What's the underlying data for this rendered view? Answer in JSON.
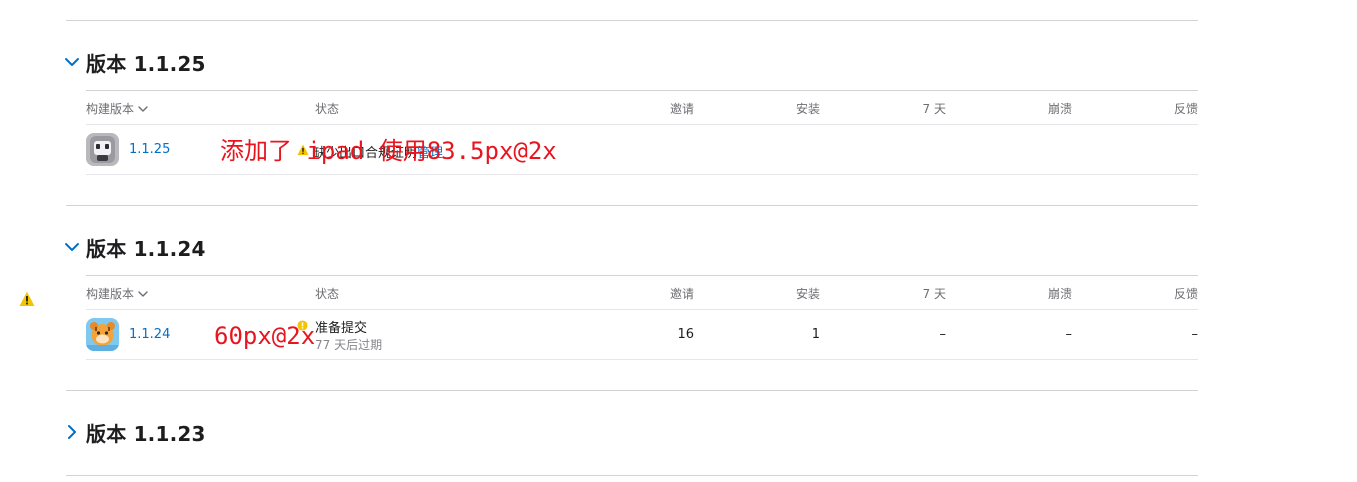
{
  "columns": {
    "build": "构建版本",
    "status": "状态",
    "invites": "邀请",
    "installs": "安装",
    "seven_days": "7 天",
    "crashes": "崩溃",
    "feedback": "反馈"
  },
  "sections": [
    {
      "title": "版本 1.1.25",
      "expanded": true,
      "build": {
        "number": "1.1.25",
        "status_prefix": "缺少出口合规证明",
        "status_link": "管理",
        "annotation": "添加了 ipad 使用83.5px@2x"
      }
    },
    {
      "title": "版本 1.1.24",
      "expanded": true,
      "build": {
        "number": "1.1.24",
        "status": "准备提交",
        "status_sub": "77 天后过期",
        "invites": "16",
        "installs": "1",
        "seven_days": "–",
        "crashes": "–",
        "feedback": "–",
        "annotation": "60px@2x"
      }
    },
    {
      "title": "版本 1.1.23",
      "expanded": false
    }
  ],
  "colors": {
    "accent": "#0070c9",
    "warning": "#f5c400",
    "annotation": "#e8141e"
  },
  "icons": {
    "expand": "chevron-down-icon",
    "collapse": "chevron-right-icon",
    "sort": "sort-chevron-icon",
    "warning": "warning-icon",
    "status_dot": "yellow-status-icon"
  }
}
